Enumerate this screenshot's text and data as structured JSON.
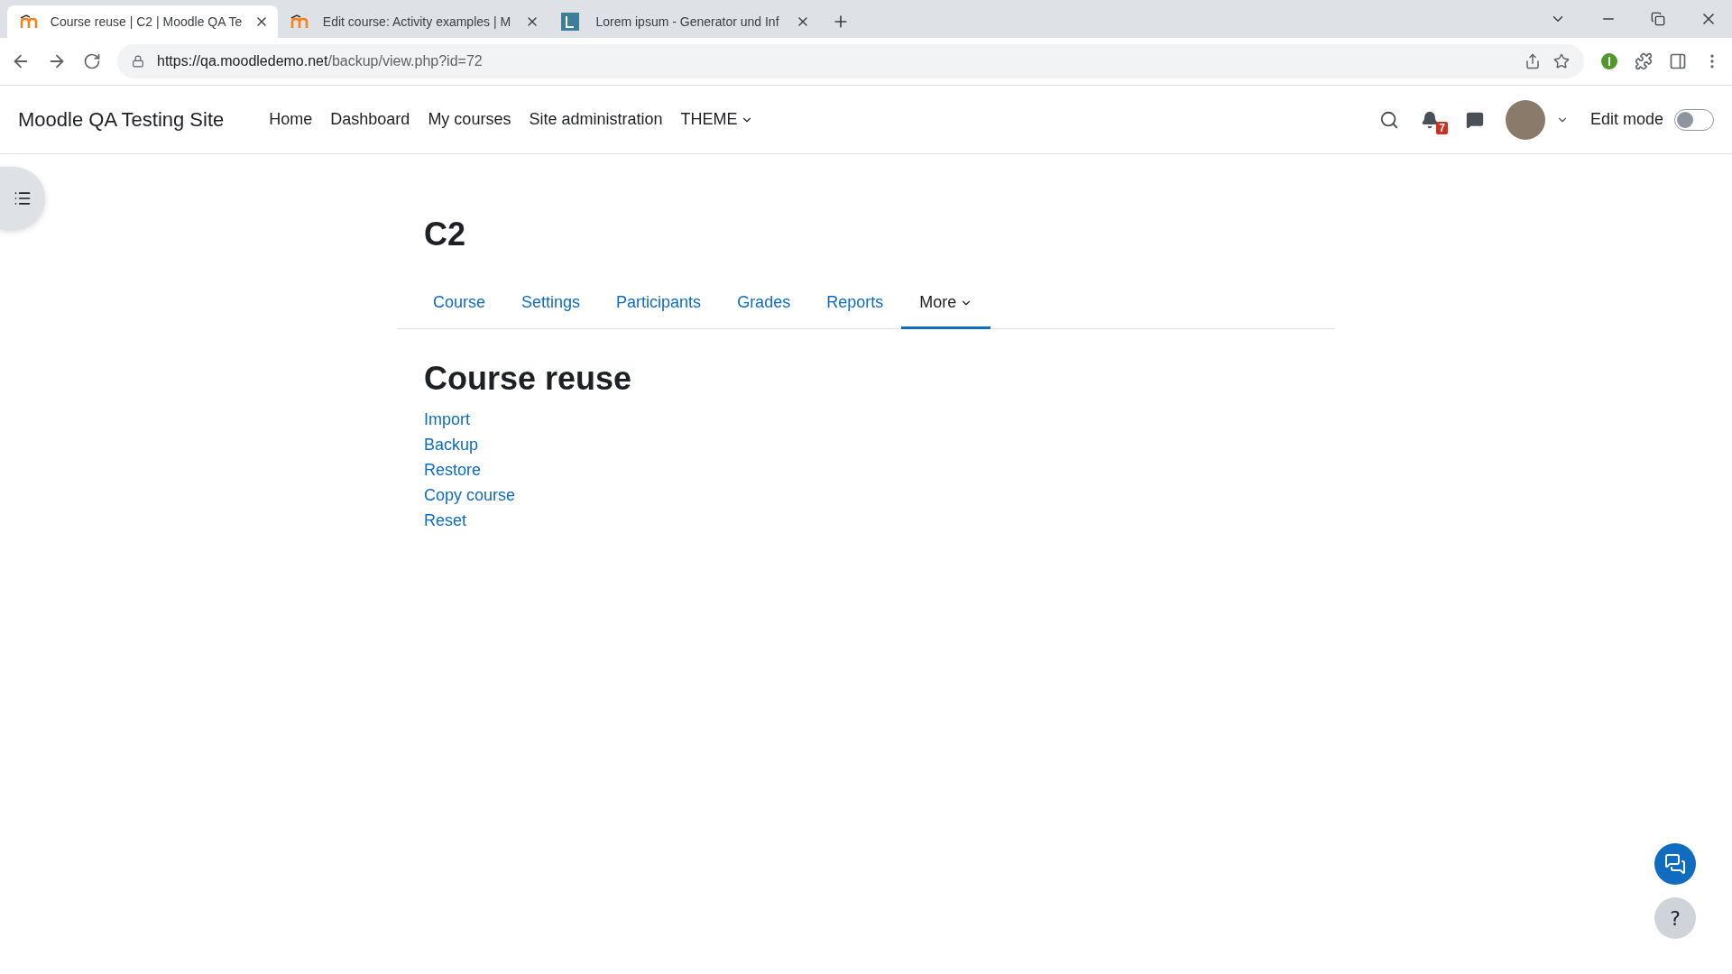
{
  "browser": {
    "tabs": [
      {
        "title": "Course reuse | C2 | Moodle QA Te",
        "kind": "moodle",
        "selected": true
      },
      {
        "title": "Edit course: Activity examples | M",
        "kind": "moodle",
        "selected": false
      },
      {
        "title": "Lorem ipsum - Generator und Inf",
        "kind": "letter",
        "selected": false
      }
    ],
    "url_host": "https://qa.moodledemo.net",
    "url_path": "/backup/view.php?id=72"
  },
  "navbar": {
    "site_name": "Moodle QA Testing Site",
    "menu": [
      {
        "label": "Home",
        "dropdown": false
      },
      {
        "label": "Dashboard",
        "dropdown": false
      },
      {
        "label": "My courses",
        "dropdown": false
      },
      {
        "label": "Site administration",
        "dropdown": false
      },
      {
        "label": "THEME",
        "dropdown": true
      }
    ],
    "notification_count": "7",
    "edit_mode": {
      "label": "Edit mode",
      "on": false
    }
  },
  "course": {
    "title": "C2",
    "tabs": [
      {
        "label": "Course",
        "selected": false,
        "dropdown": false
      },
      {
        "label": "Settings",
        "selected": false,
        "dropdown": false
      },
      {
        "label": "Participants",
        "selected": false,
        "dropdown": false
      },
      {
        "label": "Grades",
        "selected": false,
        "dropdown": false
      },
      {
        "label": "Reports",
        "selected": false,
        "dropdown": false
      },
      {
        "label": "More",
        "selected": true,
        "dropdown": true
      }
    ]
  },
  "page": {
    "heading": "Course reuse",
    "links": [
      "Import",
      "Backup",
      "Restore",
      "Copy course",
      "Reset"
    ]
  },
  "help_button": "?"
}
